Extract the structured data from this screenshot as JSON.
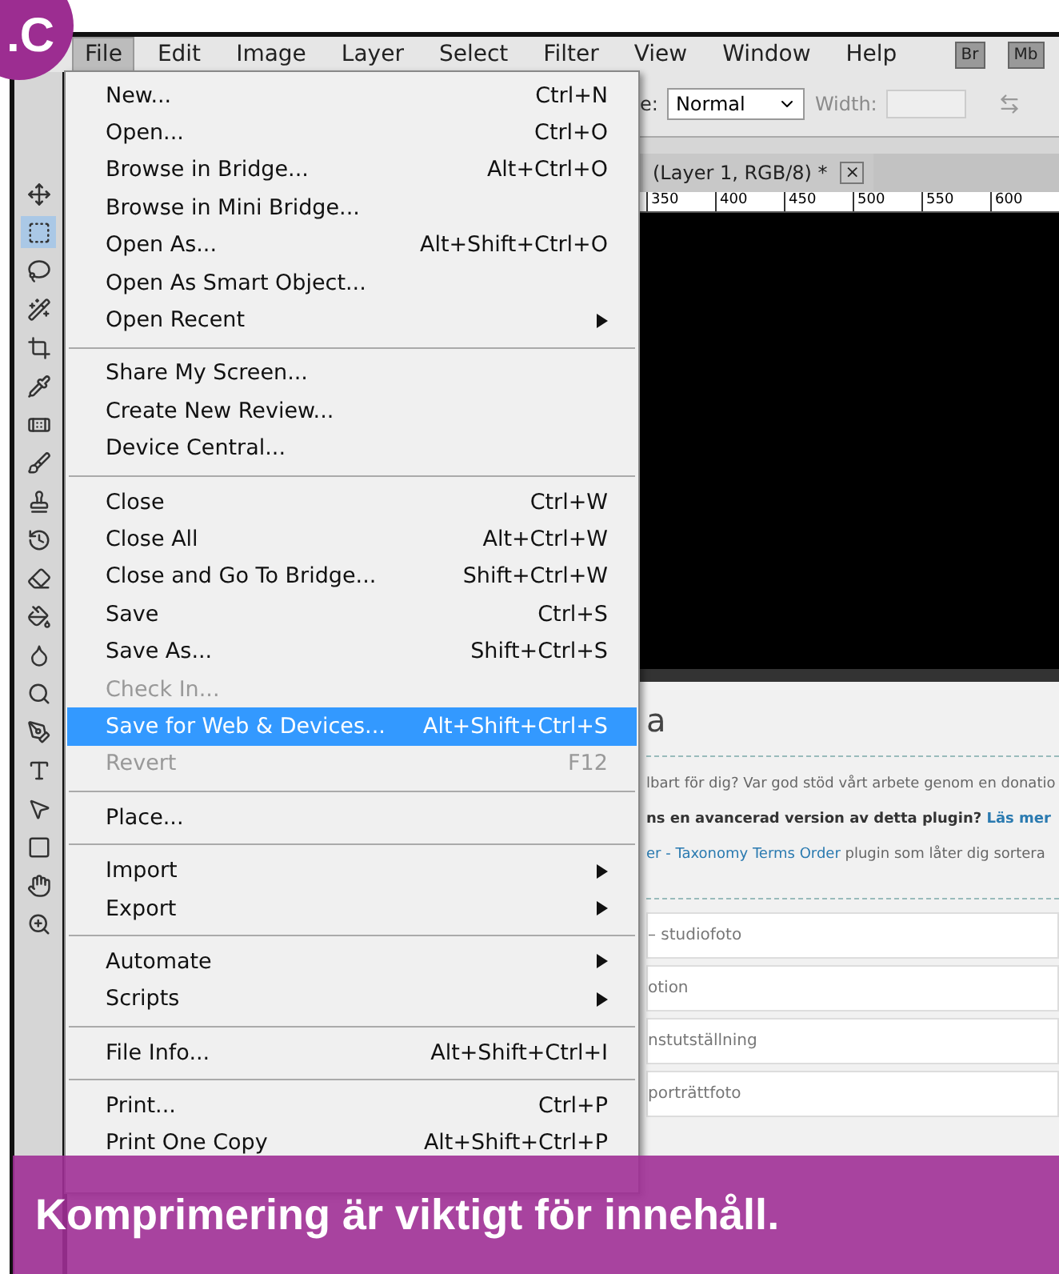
{
  "badge": ".C",
  "menubar": {
    "items": [
      {
        "label": "File",
        "selected": true
      },
      {
        "label": "Edit",
        "selected": false
      },
      {
        "label": "Image",
        "selected": false
      },
      {
        "label": "Layer",
        "selected": false
      },
      {
        "label": "Select",
        "selected": false
      },
      {
        "label": "Filter",
        "selected": false
      },
      {
        "label": "View",
        "selected": false
      },
      {
        "label": "Window",
        "selected": false
      },
      {
        "label": "Help",
        "selected": false
      }
    ],
    "app_buttons": [
      "Br",
      "Mb"
    ]
  },
  "options_bar": {
    "style_label": "e:",
    "mode": "Normal",
    "width_label": "Width:"
  },
  "document_tab": {
    "title": "(Layer 1, RGB/8) *",
    "close": "×"
  },
  "ruler": [
    "350",
    "400",
    "450",
    "500",
    "550",
    "600"
  ],
  "tools": [
    {
      "kind": "move",
      "selected": false
    },
    {
      "kind": "marquee",
      "selected": true
    },
    {
      "kind": "lasso",
      "selected": false
    },
    {
      "kind": "wand",
      "selected": false
    },
    {
      "kind": "crop",
      "selected": false
    },
    {
      "kind": "eyedropper",
      "selected": false
    },
    {
      "kind": "bandage",
      "selected": false
    },
    {
      "kind": "brush",
      "selected": false
    },
    {
      "kind": "stamp",
      "selected": false
    },
    {
      "kind": "history",
      "selected": false
    },
    {
      "kind": "eraser",
      "selected": false
    },
    {
      "kind": "bucket",
      "selected": false
    },
    {
      "kind": "blur",
      "selected": false
    },
    {
      "kind": "dodge",
      "selected": false
    },
    {
      "kind": "pen",
      "selected": false
    },
    {
      "kind": "type",
      "selected": false
    },
    {
      "kind": "pointer",
      "selected": false
    },
    {
      "kind": "shape",
      "selected": false
    },
    {
      "kind": "hand",
      "selected": false
    },
    {
      "kind": "zoom",
      "selected": false
    }
  ],
  "file_menu": [
    [
      {
        "label": "New...",
        "shortcut": "Ctrl+N",
        "disabled": false,
        "selected": false,
        "submenu": false
      },
      {
        "label": "Open...",
        "shortcut": "Ctrl+O",
        "disabled": false,
        "selected": false,
        "submenu": false
      },
      {
        "label": "Browse in Bridge...",
        "shortcut": "Alt+Ctrl+O",
        "disabled": false,
        "selected": false,
        "submenu": false
      },
      {
        "label": "Browse in Mini Bridge...",
        "disabled": false,
        "selected": false,
        "submenu": false
      },
      {
        "label": "Open As...",
        "shortcut": "Alt+Shift+Ctrl+O",
        "disabled": false,
        "selected": false,
        "submenu": false
      },
      {
        "label": "Open As Smart Object...",
        "disabled": false,
        "selected": false,
        "submenu": false
      },
      {
        "label": "Open Recent",
        "disabled": false,
        "selected": false,
        "submenu": true
      }
    ],
    [
      {
        "label": "Share My Screen...",
        "disabled": false,
        "selected": false,
        "submenu": false
      },
      {
        "label": "Create New Review...",
        "disabled": false,
        "selected": false,
        "submenu": false
      },
      {
        "label": "Device Central...",
        "disabled": false,
        "selected": false,
        "submenu": false
      }
    ],
    [
      {
        "label": "Close",
        "shortcut": "Ctrl+W",
        "disabled": false,
        "selected": false,
        "submenu": false
      },
      {
        "label": "Close All",
        "shortcut": "Alt+Ctrl+W",
        "disabled": false,
        "selected": false,
        "submenu": false
      },
      {
        "label": "Close and Go To Bridge...",
        "shortcut": "Shift+Ctrl+W",
        "disabled": false,
        "selected": false,
        "submenu": false
      },
      {
        "label": "Save",
        "shortcut": "Ctrl+S",
        "disabled": false,
        "selected": false,
        "submenu": false
      },
      {
        "label": "Save As...",
        "shortcut": "Shift+Ctrl+S",
        "disabled": false,
        "selected": false,
        "submenu": false
      },
      {
        "label": "Check In...",
        "disabled": true,
        "selected": false,
        "submenu": false
      },
      {
        "label": "Save for Web & Devices...",
        "shortcut": "Alt+Shift+Ctrl+S",
        "disabled": false,
        "selected": true,
        "submenu": false
      },
      {
        "label": "Revert",
        "shortcut": "F12",
        "disabled": true,
        "selected": false,
        "submenu": false
      }
    ],
    [
      {
        "label": "Place...",
        "disabled": false,
        "selected": false,
        "submenu": false
      }
    ],
    [
      {
        "label": "Import",
        "disabled": false,
        "selected": false,
        "submenu": true
      },
      {
        "label": "Export",
        "disabled": false,
        "selected": false,
        "submenu": true
      }
    ],
    [
      {
        "label": "Automate",
        "disabled": false,
        "selected": false,
        "submenu": true
      },
      {
        "label": "Scripts",
        "disabled": false,
        "selected": false,
        "submenu": true
      }
    ],
    [
      {
        "label": "File Info...",
        "shortcut": "Alt+Shift+Ctrl+I",
        "disabled": false,
        "selected": false,
        "submenu": false
      }
    ],
    [
      {
        "label": "Print...",
        "shortcut": "Ctrl+P",
        "disabled": false,
        "selected": false,
        "submenu": false
      },
      {
        "label": "Print One Copy",
        "shortcut": "Alt+Shift+Ctrl+P",
        "disabled": false,
        "selected": false,
        "submenu": false
      }
    ]
  ],
  "web_page": {
    "heading": "a",
    "donation_text": "lbart för dig? Var god stöd vårt arbete genom en donatio",
    "advanced_text": "ns en avancerad version av detta plugin?",
    "advanced_link": "Läs mer",
    "plugin_link": "er - Taxonomy Terms Order",
    "plugin_text": " plugin som låter dig sortera",
    "rows": [
      "– studiofoto",
      "otion",
      "nstutställning",
      "porträttfoto"
    ]
  },
  "banner": "Komprimering är viktigt för innehåll."
}
